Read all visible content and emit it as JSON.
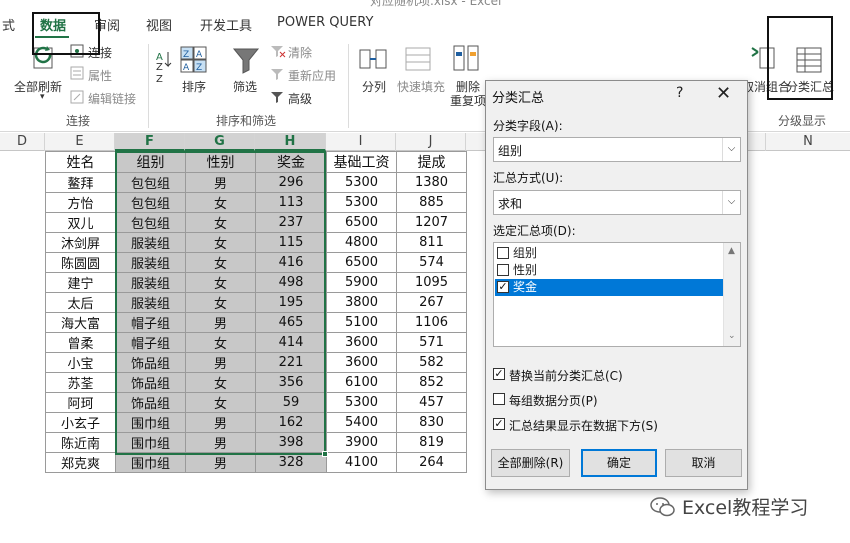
{
  "window": {
    "title_fragment": "对应随机项.xlsx - Excel"
  },
  "menu": {
    "tabs": [
      {
        "label": "式"
      },
      {
        "label": "数据",
        "active": true
      },
      {
        "label": "审阅"
      },
      {
        "label": "视图"
      },
      {
        "label": "开发工具"
      },
      {
        "label": "POWER QUERY"
      }
    ]
  },
  "ribbon": {
    "connections": {
      "refresh_all": "全部刷新",
      "connections": "连接",
      "properties": "属性",
      "edit_links": "编辑链接",
      "group_label": "连接"
    },
    "sort_filter": {
      "sort": "排序",
      "filter": "筛选",
      "clear": "清除",
      "reapply": "重新应用",
      "advanced": "高级",
      "group_label": "排序和筛选"
    },
    "data_tools": {
      "text_to_columns": "分列",
      "flash_fill": "快速填充",
      "remove_duplicates_1": "删除",
      "remove_duplicates_2": "重复项"
    },
    "outline": {
      "ungroup": "取消组合",
      "subtotal": "分类汇总",
      "group_label": "分级显示"
    }
  },
  "columns": [
    "D",
    "E",
    "F",
    "G",
    "H",
    "I",
    "J",
    "N"
  ],
  "table": {
    "headers": [
      "姓名",
      "组别",
      "性别",
      "奖金",
      "基础工资",
      "提成"
    ],
    "rows": [
      [
        "鳌拜",
        "包包组",
        "男",
        "296",
        "5300",
        "1380"
      ],
      [
        "方怡",
        "包包组",
        "女",
        "113",
        "5300",
        "885"
      ],
      [
        "双儿",
        "包包组",
        "女",
        "237",
        "6500",
        "1207"
      ],
      [
        "沐剑屏",
        "服装组",
        "女",
        "115",
        "4800",
        "811"
      ],
      [
        "陈圆圆",
        "服装组",
        "女",
        "416",
        "6500",
        "574"
      ],
      [
        "建宁",
        "服装组",
        "女",
        "498",
        "5900",
        "1095"
      ],
      [
        "太后",
        "服装组",
        "女",
        "195",
        "3800",
        "267"
      ],
      [
        "海大富",
        "帽子组",
        "男",
        "465",
        "5100",
        "1106"
      ],
      [
        "曾柔",
        "帽子组",
        "女",
        "414",
        "3600",
        "571"
      ],
      [
        "小宝",
        "饰品组",
        "男",
        "221",
        "3600",
        "582"
      ],
      [
        "苏荃",
        "饰品组",
        "女",
        "356",
        "6100",
        "852"
      ],
      [
        "阿珂",
        "饰品组",
        "女",
        "59",
        "5300",
        "457"
      ],
      [
        "小玄子",
        "围巾组",
        "男",
        "162",
        "5400",
        "830"
      ],
      [
        "陈近南",
        "围巾组",
        "男",
        "398",
        "3900",
        "819"
      ],
      [
        "郑克爽",
        "围巾组",
        "男",
        "328",
        "4100",
        "264"
      ]
    ]
  },
  "dialog": {
    "title": "分类汇总",
    "help": "?",
    "close": "✕",
    "group_by_label": "分类字段(A):",
    "group_by_value": "组别",
    "function_label": "汇总方式(U):",
    "function_value": "求和",
    "add_to_label": "选定汇总项(D):",
    "add_to_items": [
      {
        "label": "组别",
        "checked": false
      },
      {
        "label": "性别",
        "checked": false
      },
      {
        "label": "奖金",
        "checked": true
      }
    ],
    "replace_current": {
      "label": "替换当前分类汇总(C)",
      "checked": true
    },
    "page_break": {
      "label": "每组数据分页(P)",
      "checked": false
    },
    "summary_below": {
      "label": "汇总结果显示在数据下方(S)",
      "checked": true
    },
    "remove_all": "全部删除(R)",
    "ok": "确定",
    "cancel": "取消"
  },
  "watermark": {
    "text": "Excel教程学习"
  },
  "colors": {
    "accent": "#217346",
    "selection": "#c8c8c8",
    "highlight": "#0078d7"
  }
}
